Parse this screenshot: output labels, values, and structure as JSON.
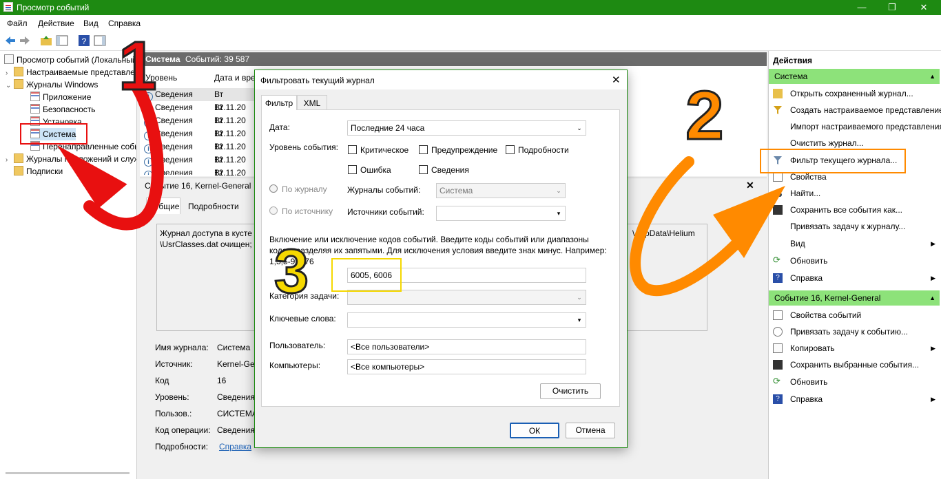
{
  "window": {
    "title": "Просмотр событий",
    "min": "—",
    "max": "❐",
    "close": "✕"
  },
  "menu": [
    "Файл",
    "Действие",
    "Вид",
    "Справка"
  ],
  "tree": {
    "root": "Просмотр событий (Локальный)",
    "items": [
      {
        "label": "Настраиваемые представления"
      },
      {
        "label": "Журналы Windows"
      },
      {
        "label": "Приложение"
      },
      {
        "label": "Безопасность"
      },
      {
        "label": "Установка"
      },
      {
        "label": "Система"
      },
      {
        "label": "Перенаправленные события"
      },
      {
        "label": "Журналы приложений и служб"
      },
      {
        "label": "Подписки"
      }
    ]
  },
  "center": {
    "log_name": "Система",
    "count": "Событий: 39 587",
    "columns": [
      "Уровень",
      "Дата и время"
    ],
    "rows": [
      {
        "level": "Сведения",
        "date": "Вт 12.11.20"
      },
      {
        "level": "Сведения",
        "date": "Вт 12.11.20"
      },
      {
        "level": "Сведения",
        "date": "Вт 12.11.20"
      },
      {
        "level": "Сведения",
        "date": "Вт 12.11.20"
      },
      {
        "level": "Сведения",
        "date": "Вт 12.11.20"
      },
      {
        "level": "Сведения",
        "date": "Вт 12.11.20"
      },
      {
        "level": "Сведения",
        "date": "Вт 12.11.20"
      }
    ],
    "details_title": "Событие 16, Kernel-General",
    "tabs": [
      "Общие",
      "Подробности"
    ],
    "desc_start": "Журнал доступа в кусте \\",
    "desc_line2": "\\UsrClasses.dat очищен;",
    "desc_right": "\\AppData\\Helium",
    "props": [
      {
        "label": "Имя журнала:",
        "value": "Система"
      },
      {
        "label": "Источник:",
        "value": "Kernel-General"
      },
      {
        "label": "Код",
        "value": "16"
      },
      {
        "label": "Уровень:",
        "value": "Сведения"
      },
      {
        "label": "Пользов.:",
        "value": "СИСТЕМА"
      },
      {
        "label": "Код операции:",
        "value": "Сведения"
      },
      {
        "label": "Подробности:",
        "value": "Справка"
      }
    ]
  },
  "actions": {
    "title": "Действия",
    "section1": "Система",
    "items1": [
      {
        "label": "Открыть сохраненный журнал...",
        "icon": "folder-open-icon"
      },
      {
        "label": "Создать настраиваемое представление...",
        "icon": "filter-add-icon"
      },
      {
        "label": "Импорт настраиваемого представления...",
        "icon": ""
      },
      {
        "label": "Очистить журнал...",
        "icon": ""
      },
      {
        "label": "Фильтр текущего журнала...",
        "icon": "filter-icon"
      },
      {
        "label": "Свойства",
        "icon": "properties-icon"
      },
      {
        "label": "Найти...",
        "icon": "binoculars-icon"
      },
      {
        "label": "Сохранить все события как...",
        "icon": "save-icon"
      },
      {
        "label": "Привязать задачу к журналу...",
        "icon": ""
      },
      {
        "label": "Вид",
        "icon": ""
      },
      {
        "label": "Обновить",
        "icon": "refresh-icon"
      },
      {
        "label": "Справка",
        "icon": "help-icon"
      }
    ],
    "section2": "Событие 16, Kernel-General",
    "items2": [
      {
        "label": "Свойства событий",
        "icon": "properties-icon"
      },
      {
        "label": "Привязать задачу к событию...",
        "icon": "task-icon"
      },
      {
        "label": "Копировать",
        "icon": "copy-icon"
      },
      {
        "label": "Сохранить выбранные события...",
        "icon": "save-icon"
      },
      {
        "label": "Обновить",
        "icon": "refresh-icon"
      },
      {
        "label": "Справка",
        "icon": "help-icon"
      }
    ]
  },
  "dialog": {
    "title": "Фильтровать текущий журнал",
    "tabs": [
      "Фильтр",
      "XML"
    ],
    "date_label": "Дата:",
    "date_value": "Последние 24 часа",
    "level_label": "Уровень события:",
    "levels": [
      "Критическое",
      "Предупреждение",
      "Подробности",
      "Ошибка",
      "Сведения"
    ],
    "by_log": "По журналу",
    "by_source": "По источнику",
    "logs_label": "Журналы событий:",
    "logs_value": "Система",
    "sources_label": "Источники событий:",
    "info_line1": "Включение или исключение кодов событий. Введите коды событий или диапазоны",
    "info_line2": "кодов, разделяя их запятыми. Для исключения условия введите знак минус. Например:",
    "info_line3": "1,3,5-99,-76",
    "ids_value": "6005, 6006",
    "task_label": "Категория задачи:",
    "keywords_label": "Ключевые слова:",
    "user_label": "Пользователь:",
    "user_value": "<Все пользователи>",
    "computer_label": "Компьютеры:",
    "computer_value": "<Все компьютеры>",
    "clear_btn": "Очистить",
    "ok_btn": "ОК",
    "cancel_btn": "Отмена"
  },
  "annotations": {
    "n1": "1",
    "n2": "2",
    "n3": "3"
  },
  "colors": {
    "accent_green": "#1e8a12",
    "section_green": "#8de27a",
    "arrow_red": "#e81010",
    "arrow_orange": "#ff8a00",
    "number_yellow": "#f5d800"
  }
}
